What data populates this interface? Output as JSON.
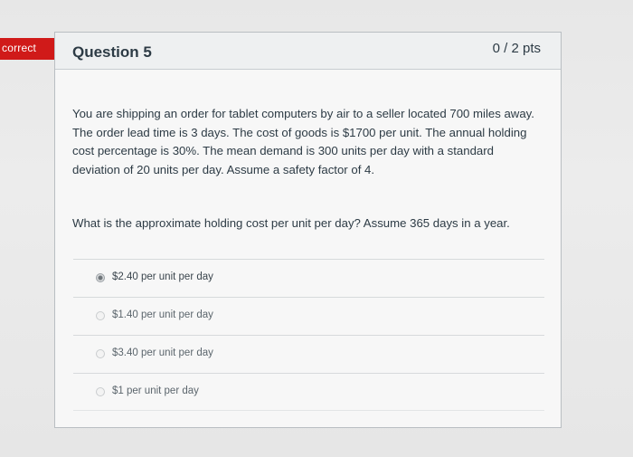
{
  "status": {
    "label": "correct",
    "color": "#d01a19"
  },
  "question": {
    "title": "Question 5",
    "points": "0 / 2 pts",
    "body": "You are shipping an order for tablet computers by air to a seller located 700 miles away. The order lead time is 3 days. The cost of goods is $1700 per unit. The annual holding cost percentage is 30%. The mean demand is 300 units per day with a standard deviation of 20 units per day. Assume a safety factor of 4.",
    "prompt": "What is the approximate holding cost per unit per day? Assume 365 days in a year."
  },
  "answers": [
    {
      "label": "$2.40 per unit per day",
      "selected": true
    },
    {
      "label": "$1.40 per unit per day",
      "selected": false
    },
    {
      "label": "$3.40 per unit per day",
      "selected": false
    },
    {
      "label": "$1 per unit per day",
      "selected": false
    }
  ]
}
